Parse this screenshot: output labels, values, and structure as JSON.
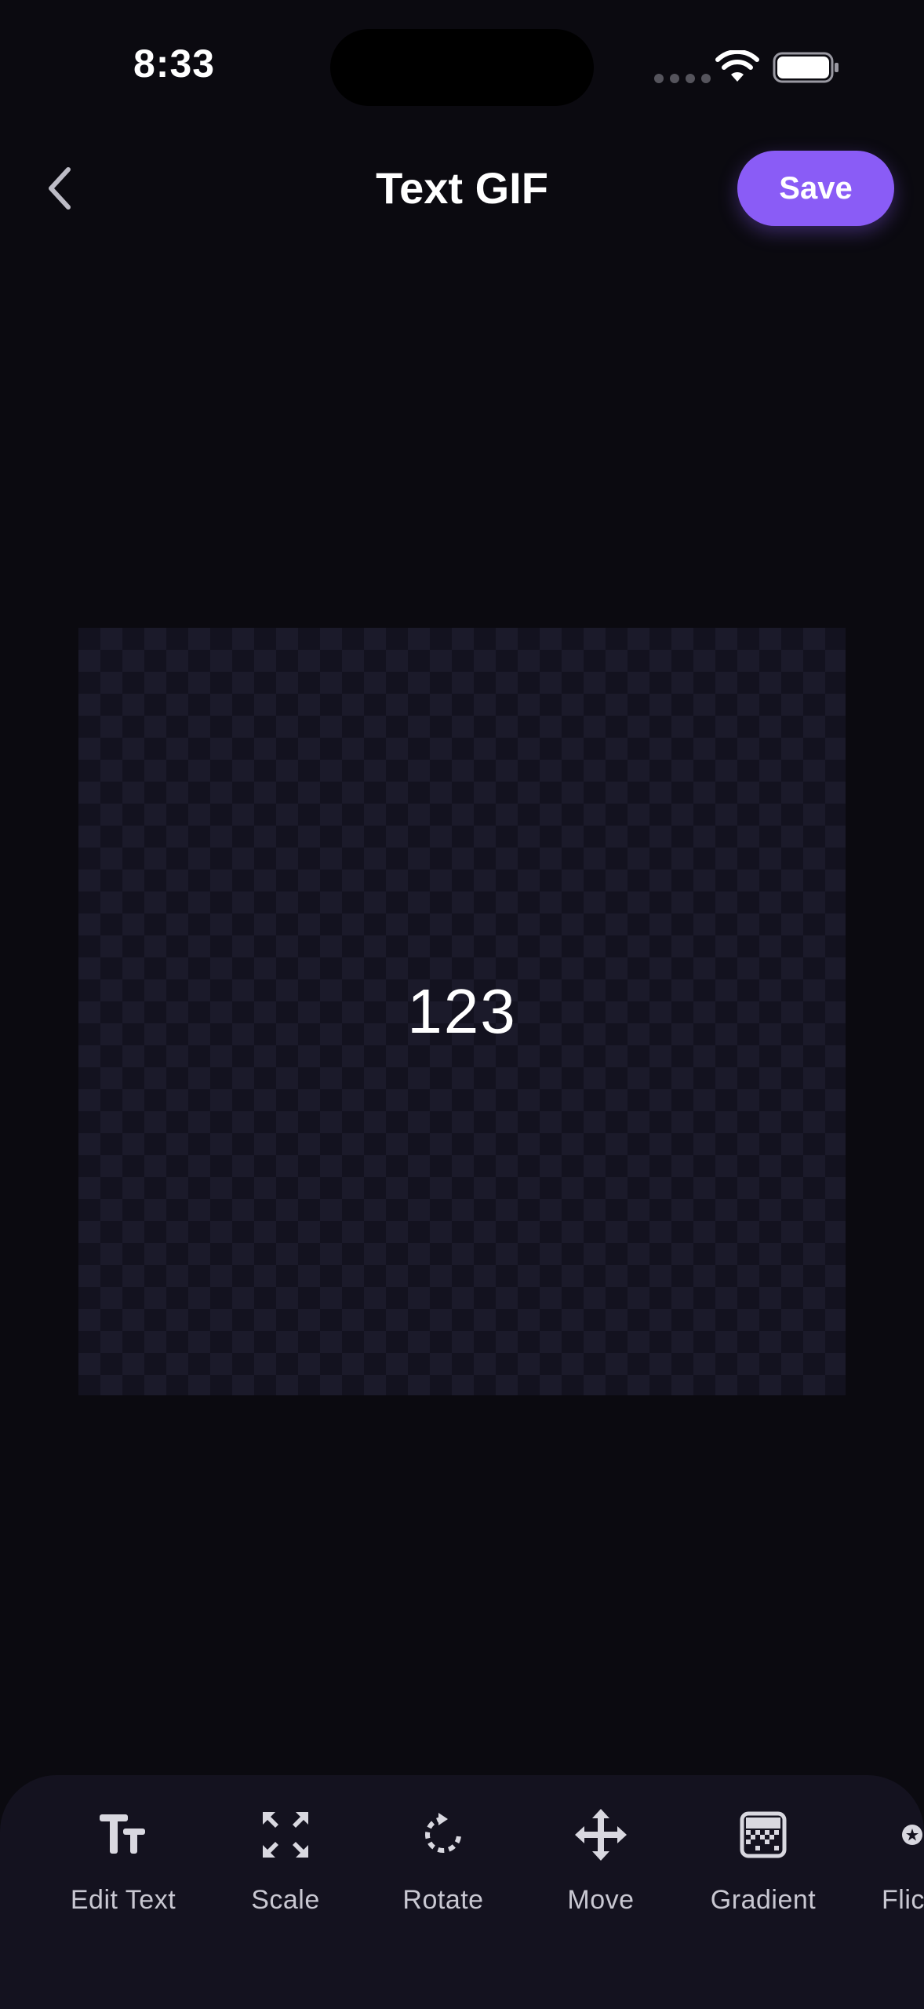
{
  "status_bar": {
    "time": "8:33"
  },
  "header": {
    "title": "Text GIF",
    "save_label": "Save",
    "back_icon": "chevron-left-icon"
  },
  "canvas": {
    "text": "123"
  },
  "toolbar": {
    "tools": [
      {
        "label": "Edit Text",
        "icon": "text-size-icon"
      },
      {
        "label": "Scale",
        "icon": "expand-arrows-icon"
      },
      {
        "label": "Rotate",
        "icon": "rotate-icon"
      },
      {
        "label": "Move",
        "icon": "move-arrows-icon"
      },
      {
        "label": "Gradient",
        "icon": "gradient-icon"
      },
      {
        "label": "Flic",
        "icon": "flicker-icon"
      }
    ]
  },
  "colors": {
    "background": "#0b0a10",
    "accent": "#8a5cf6",
    "toolbar": "#14121f"
  }
}
